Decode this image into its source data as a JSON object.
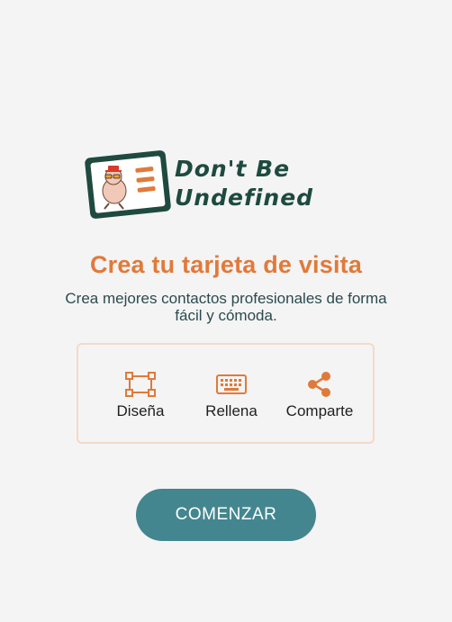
{
  "logo": {
    "line1": "Don't Be",
    "line2": "Undefined"
  },
  "hero": {
    "title": "Crea tu tarjeta de visita",
    "subtitle": "Crea mejores contactos profesionales de forma fácil y cómoda."
  },
  "features": [
    {
      "label": "Diseña",
      "icon": "design-icon"
    },
    {
      "label": "Rellena",
      "icon": "keyboard-icon"
    },
    {
      "label": "Comparte",
      "icon": "share-icon"
    }
  ],
  "cta": {
    "label": "COMENZAR"
  },
  "colors": {
    "accent": "#e07a3a",
    "button": "#43868f",
    "logo_dark": "#1e4a3f",
    "background": "#f4f4f4"
  }
}
